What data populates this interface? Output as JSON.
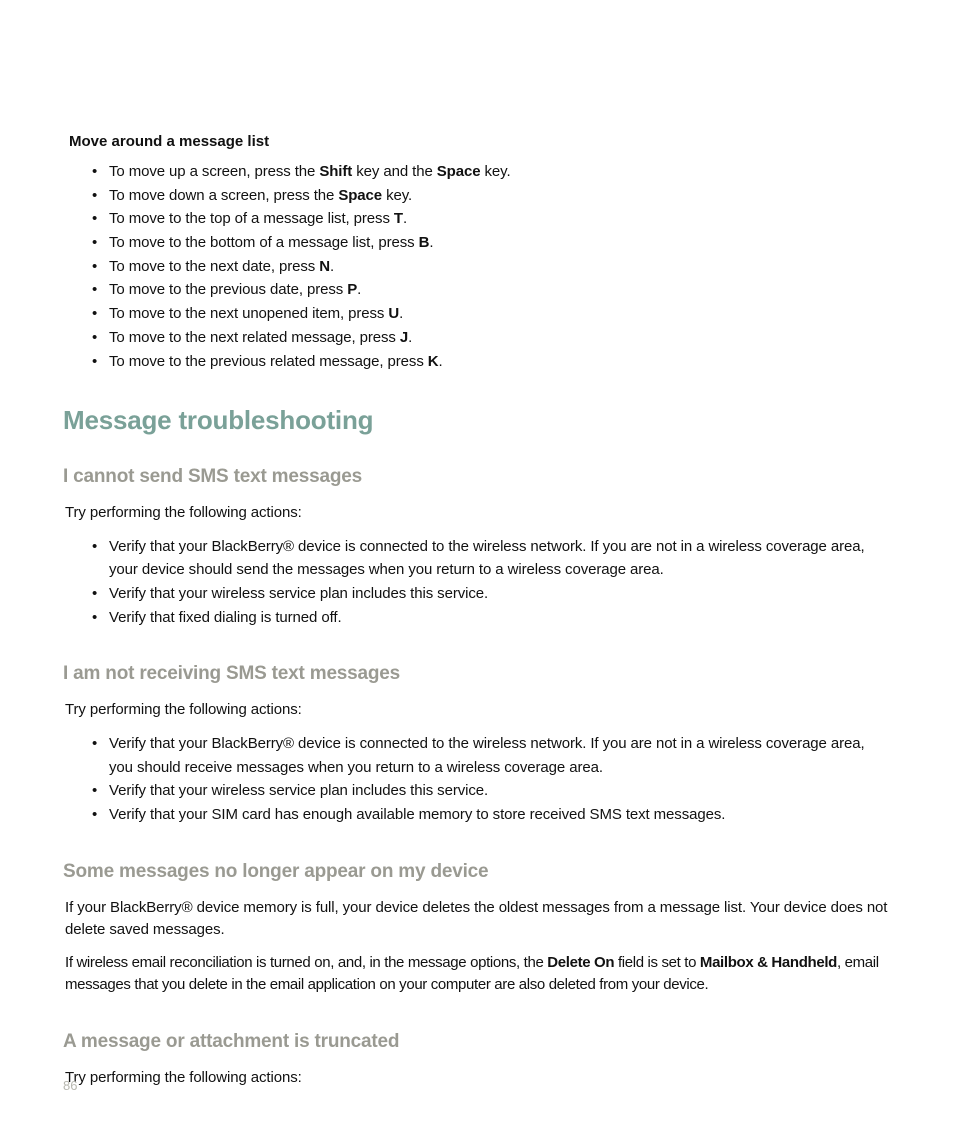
{
  "moveList": {
    "heading": "Move around a message list",
    "items": [
      {
        "pre": "To move up a screen, press the ",
        "b1": "Shift",
        "mid": " key and the ",
        "b2": "Space",
        "post": " key."
      },
      {
        "pre": "To move down a screen, press the ",
        "b1": "Space",
        "post": " key."
      },
      {
        "pre": "To move to the top of a message list, press ",
        "b1": "T",
        "post": "."
      },
      {
        "pre": "To move to the bottom of a message list, press ",
        "b1": "B",
        "post": "."
      },
      {
        "pre": "To move to the next date, press ",
        "b1": "N",
        "post": "."
      },
      {
        "pre": "To move to the previous date, press ",
        "b1": "P",
        "post": "."
      },
      {
        "pre": "To move to the next unopened item, press ",
        "b1": "U",
        "post": "."
      },
      {
        "pre": "To move to the next related message, press ",
        "b1": "J",
        "post": "."
      },
      {
        "pre": "To move to the previous related message, press ",
        "b1": "K",
        "post": "."
      }
    ]
  },
  "troubleshooting": {
    "heading": "Message troubleshooting",
    "sections": {
      "cannotSend": {
        "heading": "I cannot send SMS text messages",
        "intro": "Try performing the following actions:",
        "items": [
          "Verify that your BlackBerry® device is connected to the wireless network. If you are not in a wireless coverage area, your device should send the messages when you return to a wireless coverage area.",
          "Verify that your wireless service plan includes this service.",
          "Verify that fixed dialing is turned off."
        ]
      },
      "notReceiving": {
        "heading": "I am not receiving SMS text messages",
        "intro": "Try performing the following actions:",
        "items": [
          "Verify that your BlackBerry® device is connected to the wireless network. If you are not in a wireless coverage area, you should receive messages when you return to a wireless coverage area.",
          "Verify that your wireless service plan includes this service.",
          "Verify that your SIM card has enough available memory to store received SMS text messages."
        ]
      },
      "noLonger": {
        "heading": "Some messages no longer appear on my device",
        "p1": "If your BlackBerry® device memory is full, your device deletes the oldest messages from a message list. Your device does not delete saved messages.",
        "p2a": "If wireless email reconciliation is turned on, and, in the message options, the ",
        "p2b1": "Delete On",
        "p2b": " field is set to ",
        "p2b2": "Mailbox & Handheld",
        "p2c": ", email messages that you delete in the email application on your computer are also deleted from your device."
      },
      "truncated": {
        "heading": "A message or attachment is truncated",
        "intro": "Try performing the following actions:"
      }
    }
  },
  "pageNumber": "86"
}
